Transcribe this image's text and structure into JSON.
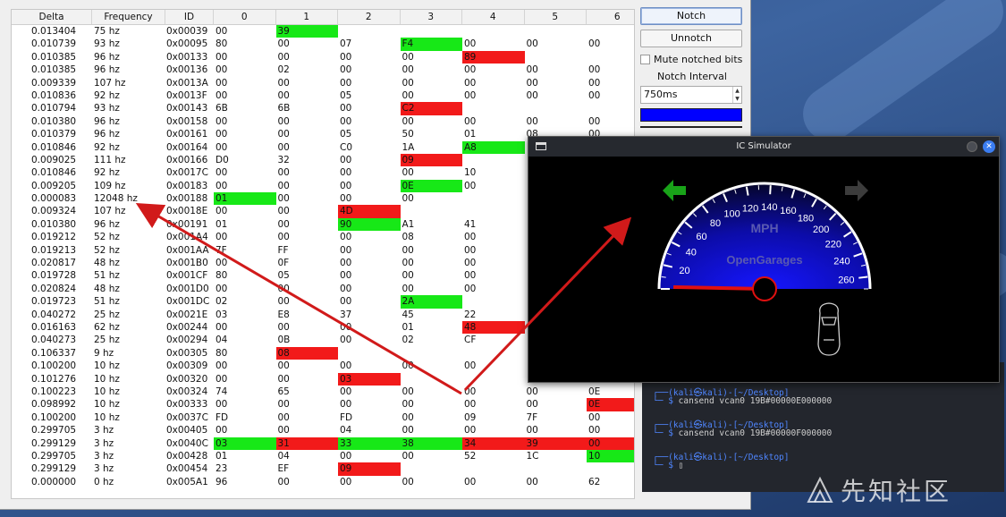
{
  "can_table": {
    "headers": [
      "Delta",
      "Frequency",
      "ID",
      "0",
      "1",
      "2",
      "3",
      "4",
      "5",
      "6"
    ],
    "rows": [
      {
        "delta": "0.013404",
        "freq": "75 hz",
        "id": "0x00039",
        "b": [
          "00",
          "39",
          "",
          "",
          "",
          "",
          ""
        ],
        "g": [
          1
        ],
        "r": []
      },
      {
        "delta": "0.010739",
        "freq": "93 hz",
        "id": "0x00095",
        "b": [
          "80",
          "00",
          "07",
          "F4",
          "00",
          "00",
          "00"
        ],
        "g": [
          3
        ],
        "r": []
      },
      {
        "delta": "0.010385",
        "freq": "96 hz",
        "id": "0x00133",
        "b": [
          "00",
          "00",
          "00",
          "00",
          "89",
          "",
          ""
        ],
        "g": [],
        "r": [
          4
        ]
      },
      {
        "delta": "0.010385",
        "freq": "96 hz",
        "id": "0x00136",
        "b": [
          "00",
          "02",
          "00",
          "00",
          "00",
          "00",
          "00"
        ],
        "g": [],
        "r": []
      },
      {
        "delta": "0.009339",
        "freq": "107 hz",
        "id": "0x0013A",
        "b": [
          "00",
          "00",
          "00",
          "00",
          "00",
          "00",
          "00"
        ],
        "g": [],
        "r": []
      },
      {
        "delta": "0.010836",
        "freq": "92 hz",
        "id": "0x0013F",
        "b": [
          "00",
          "00",
          "05",
          "00",
          "00",
          "00",
          "00"
        ],
        "g": [],
        "r": []
      },
      {
        "delta": "0.010794",
        "freq": "93 hz",
        "id": "0x00143",
        "b": [
          "6B",
          "6B",
          "00",
          "C2",
          "",
          "",
          ""
        ],
        "g": [],
        "r": [
          3
        ]
      },
      {
        "delta": "0.010380",
        "freq": "96 hz",
        "id": "0x00158",
        "b": [
          "00",
          "00",
          "00",
          "00",
          "00",
          "00",
          "00"
        ],
        "g": [],
        "r": []
      },
      {
        "delta": "0.010379",
        "freq": "96 hz",
        "id": "0x00161",
        "b": [
          "00",
          "00",
          "05",
          "50",
          "01",
          "08",
          "00"
        ],
        "g": [],
        "r": []
      },
      {
        "delta": "0.010846",
        "freq": "92 hz",
        "id": "0x00164",
        "b": [
          "00",
          "00",
          "C0",
          "1A",
          "A8",
          "",
          ""
        ],
        "g": [
          4
        ],
        "r": []
      },
      {
        "delta": "0.009025",
        "freq": "111 hz",
        "id": "0x00166",
        "b": [
          "D0",
          "32",
          "00",
          "09",
          "",
          "",
          ""
        ],
        "g": [],
        "r": [
          3
        ]
      },
      {
        "delta": "0.010846",
        "freq": "92 hz",
        "id": "0x0017C",
        "b": [
          "00",
          "00",
          "00",
          "00",
          "10",
          "",
          ""
        ],
        "g": [],
        "r": []
      },
      {
        "delta": "0.009205",
        "freq": "109 hz",
        "id": "0x00183",
        "b": [
          "00",
          "00",
          "00",
          "0E",
          "00",
          "",
          ""
        ],
        "g": [
          3
        ],
        "r": []
      },
      {
        "delta": "0.000083",
        "freq": "12048 hz",
        "id": "0x00188",
        "b": [
          "01",
          "00",
          "00",
          "00",
          "",
          "",
          ""
        ],
        "g": [
          0
        ],
        "r": []
      },
      {
        "delta": "0.009324",
        "freq": "107 hz",
        "id": "0x0018E",
        "b": [
          "00",
          "00",
          "4D",
          "",
          "",
          "",
          ""
        ],
        "g": [],
        "r": [
          2
        ]
      },
      {
        "delta": "0.010380",
        "freq": "96 hz",
        "id": "0x00191",
        "b": [
          "01",
          "00",
          "90",
          "A1",
          "41",
          "",
          ""
        ],
        "g": [
          2
        ],
        "r": []
      },
      {
        "delta": "0.019212",
        "freq": "52 hz",
        "id": "0x001A4",
        "b": [
          "00",
          "00",
          "00",
          "08",
          "00",
          "",
          ""
        ],
        "g": [],
        "r": []
      },
      {
        "delta": "0.019213",
        "freq": "52 hz",
        "id": "0x001AA",
        "b": [
          "7F",
          "FF",
          "00",
          "00",
          "00",
          "",
          ""
        ],
        "g": [],
        "r": []
      },
      {
        "delta": "0.020817",
        "freq": "48 hz",
        "id": "0x001B0",
        "b": [
          "00",
          "0F",
          "00",
          "00",
          "00",
          "",
          ""
        ],
        "g": [],
        "r": []
      },
      {
        "delta": "0.019728",
        "freq": "51 hz",
        "id": "0x001CF",
        "b": [
          "80",
          "05",
          "00",
          "00",
          "00",
          "",
          ""
        ],
        "g": [],
        "r": []
      },
      {
        "delta": "0.020824",
        "freq": "48 hz",
        "id": "0x001D0",
        "b": [
          "00",
          "00",
          "00",
          "00",
          "00",
          "",
          ""
        ],
        "g": [],
        "r": []
      },
      {
        "delta": "0.019723",
        "freq": "51 hz",
        "id": "0x001DC",
        "b": [
          "02",
          "00",
          "00",
          "2A",
          "",
          "",
          ""
        ],
        "g": [
          3
        ],
        "r": []
      },
      {
        "delta": "0.040272",
        "freq": "25 hz",
        "id": "0x0021E",
        "b": [
          "03",
          "E8",
          "37",
          "45",
          "22",
          "",
          ""
        ],
        "g": [],
        "r": []
      },
      {
        "delta": "0.016163",
        "freq": "62 hz",
        "id": "0x00244",
        "b": [
          "00",
          "00",
          "00",
          "01",
          "48",
          "",
          ""
        ],
        "g": [],
        "r": [
          4
        ]
      },
      {
        "delta": "0.040273",
        "freq": "25 hz",
        "id": "0x00294",
        "b": [
          "04",
          "0B",
          "00",
          "02",
          "CF",
          "",
          ""
        ],
        "g": [],
        "r": []
      },
      {
        "delta": "0.106337",
        "freq": "9 hz",
        "id": "0x00305",
        "b": [
          "80",
          "08",
          "",
          "",
          "",
          "",
          ""
        ],
        "g": [],
        "r": [
          1
        ]
      },
      {
        "delta": "0.100200",
        "freq": "10 hz",
        "id": "0x00309",
        "b": [
          "00",
          "00",
          "00",
          "00",
          "00",
          "",
          ""
        ],
        "g": [],
        "r": []
      },
      {
        "delta": "0.101276",
        "freq": "10 hz",
        "id": "0x00320",
        "b": [
          "00",
          "00",
          "03",
          "",
          "",
          "",
          ""
        ],
        "g": [],
        "r": [
          2
        ]
      },
      {
        "delta": "0.100223",
        "freq": "10 hz",
        "id": "0x00324",
        "b": [
          "74",
          "65",
          "00",
          "00",
          "00",
          "00",
          "0E"
        ],
        "g": [],
        "r": []
      },
      {
        "delta": "0.098992",
        "freq": "10 hz",
        "id": "0x00333",
        "b": [
          "00",
          "00",
          "00",
          "00",
          "00",
          "00",
          "0E"
        ],
        "g": [],
        "r": [
          6
        ]
      },
      {
        "delta": "0.100200",
        "freq": "10 hz",
        "id": "0x0037C",
        "b": [
          "FD",
          "00",
          "FD",
          "00",
          "09",
          "7F",
          "00"
        ],
        "g": [],
        "r": []
      },
      {
        "delta": "0.299705",
        "freq": "3 hz",
        "id": "0x00405",
        "b": [
          "00",
          "00",
          "04",
          "00",
          "00",
          "00",
          "00"
        ],
        "g": [],
        "r": []
      },
      {
        "delta": "0.299129",
        "freq": "3 hz",
        "id": "0x0040C",
        "b": [
          "03",
          "31",
          "33",
          "38",
          "34",
          "39",
          "00"
        ],
        "g": [
          0,
          2,
          3
        ],
        "r": [
          1,
          4,
          5,
          6
        ]
      },
      {
        "delta": "0.299705",
        "freq": "3 hz",
        "id": "0x00428",
        "b": [
          "01",
          "04",
          "00",
          "00",
          "52",
          "1C",
          "10"
        ],
        "g": [
          6
        ],
        "r": []
      },
      {
        "delta": "0.299129",
        "freq": "3 hz",
        "id": "0x00454",
        "b": [
          "23",
          "EF",
          "09",
          "",
          "",
          "",
          ""
        ],
        "g": [],
        "r": [
          2
        ]
      },
      {
        "delta": "0.000000",
        "freq": "0 hz",
        "id": "0x005A1",
        "b": [
          "96",
          "00",
          "00",
          "00",
          "00",
          "00",
          "62"
        ],
        "g": [],
        "r": []
      }
    ]
  },
  "side_panel": {
    "notch_label": "Notch",
    "unnotch_label": "Unnotch",
    "mute_label": "Mute notched bits",
    "notch_interval_label": "Notch Interval",
    "notch_interval_value": "750ms",
    "bar_color": "#0000ff"
  },
  "ic_sim": {
    "title": "IC Simulator",
    "unit_label": "MPH",
    "brand_label": "OpenGarages",
    "ticks": [
      "20",
      "40",
      "60",
      "80",
      "100",
      "120",
      "140",
      "160",
      "180",
      "200",
      "220",
      "240",
      "260"
    ],
    "speed": 0,
    "left_signal_active": true,
    "right_signal_active": false,
    "signal_on_color": "#19a319",
    "signal_off_color": "#3c3c3c"
  },
  "terminal": {
    "lines": [
      {
        "prompt_user": "(kali㉿kali)-[~/Desktop]",
        "cmd": "cansend vcan0 19B#00000E000000"
      },
      {
        "prompt_user": "(kali㉿kali)-[~/Desktop]",
        "cmd": "cansend vcan0 19B#00000F000000"
      },
      {
        "prompt_user": "(kali㉿kali)-[~/Desktop]",
        "cmd": ""
      }
    ],
    "dollar": "$"
  },
  "watermark": {
    "text": "先知社区"
  }
}
